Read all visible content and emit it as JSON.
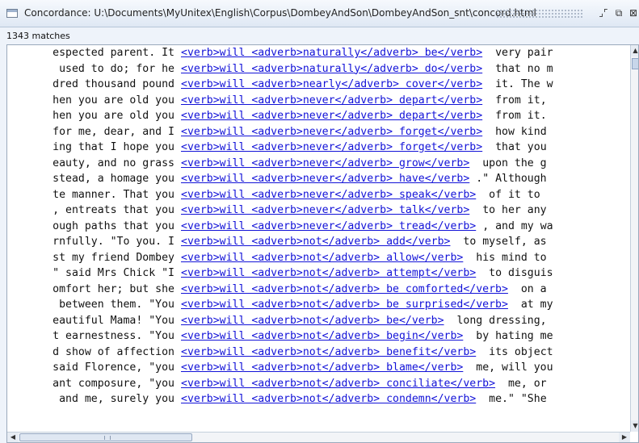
{
  "window": {
    "title": "Concordance: U:\\Documents\\MyUnitex\\English\\Corpus\\DombeyAndSon\\DombeyAndSon_snt\\concord.html",
    "iconify_glyph": "⌟⌜",
    "maximize_glyph": "⧉",
    "close_glyph": "⊠"
  },
  "match_count": "1343 matches",
  "concordance": {
    "rows": [
      {
        "left": "espected parent. It",
        "match": "<verb>will <adverb>naturally</adverb> be</verb>",
        "right": " very pair"
      },
      {
        "left": " used to do; for he",
        "match": "<verb>will <adverb>naturally</adverb> do</verb>",
        "right": " that no m"
      },
      {
        "left": "dred thousand pound",
        "match": "<verb>will <adverb>nearly</adverb> cover</verb>",
        "right": " it. The w"
      },
      {
        "left": "hen you are old you",
        "match": "<verb>will <adverb>never</adverb> depart</verb>",
        "right": " from it,"
      },
      {
        "left": "hen you are old you",
        "match": "<verb>will <adverb>never</adverb> depart</verb>",
        "right": " from it."
      },
      {
        "left": "for me, dear, and I",
        "match": "<verb>will <adverb>never</adverb> forget</verb>",
        "right": " how kind"
      },
      {
        "left": "ing that I hope you",
        "match": "<verb>will <adverb>never</adverb> forget</verb>",
        "right": " that you"
      },
      {
        "left": "eauty, and no grass",
        "match": "<verb>will <adverb>never</adverb> grow</verb>",
        "right": " upon the g"
      },
      {
        "left": "stead, a homage you",
        "match": "<verb>will <adverb>never</adverb> have</verb>",
        "right": ".\" Although"
      },
      {
        "left": "te manner. That you",
        "match": "<verb>will <adverb>never</adverb> speak</verb>",
        "right": " of it to"
      },
      {
        "left": ", entreats that you",
        "match": "<verb>will <adverb>never</adverb> talk</verb>",
        "right": " to her any"
      },
      {
        "left": "ough paths that you",
        "match": "<verb>will <adverb>never</adverb> tread</verb>",
        "right": ", and my wa"
      },
      {
        "left": "rnfully. \"To you. I",
        "match": "<verb>will <adverb>not</adverb> add</verb>",
        "right": " to myself, as"
      },
      {
        "left": "st my friend Dombey",
        "match": "<verb>will <adverb>not</adverb> allow</verb>",
        "right": " his mind to"
      },
      {
        "left": "\" said Mrs Chick \"I",
        "match": "<verb>will <adverb>not</adverb> attempt</verb>",
        "right": " to disguis"
      },
      {
        "left": "omfort her; but she",
        "match": "<verb>will <adverb>not</adverb> be comforted</verb>",
        "right": " on a"
      },
      {
        "left": " between them. \"You",
        "match": "<verb>will <adverb>not</adverb> be surprised</verb>",
        "right": " at my"
      },
      {
        "left": "eautiful Mama! \"You",
        "match": "<verb>will <adverb>not</adverb> be</verb>",
        "right": " long dressing,"
      },
      {
        "left": "t earnestness. \"You",
        "match": "<verb>will <adverb>not</adverb> begin</verb>",
        "right": " by hating me"
      },
      {
        "left": "d show of affection",
        "match": "<verb>will <adverb>not</adverb> benefit</verb>",
        "right": " its object"
      },
      {
        "left": "said Florence, \"you",
        "match": "<verb>will <adverb>not</adverb> blame</verb>",
        "right": " me, will you"
      },
      {
        "left": "ant composure, \"you",
        "match": "<verb>will <adverb>not</adverb> conciliate</verb>",
        "right": " me, or"
      },
      {
        "left": "and me, surely you",
        "match": "<verb>will <adverb>not</adverb> condemn</verb>",
        "right": " me.\" \"She"
      }
    ]
  },
  "colors": {
    "match_link": "#1212d8",
    "background": "#ffffff",
    "window_bg": "#eef3fa"
  }
}
